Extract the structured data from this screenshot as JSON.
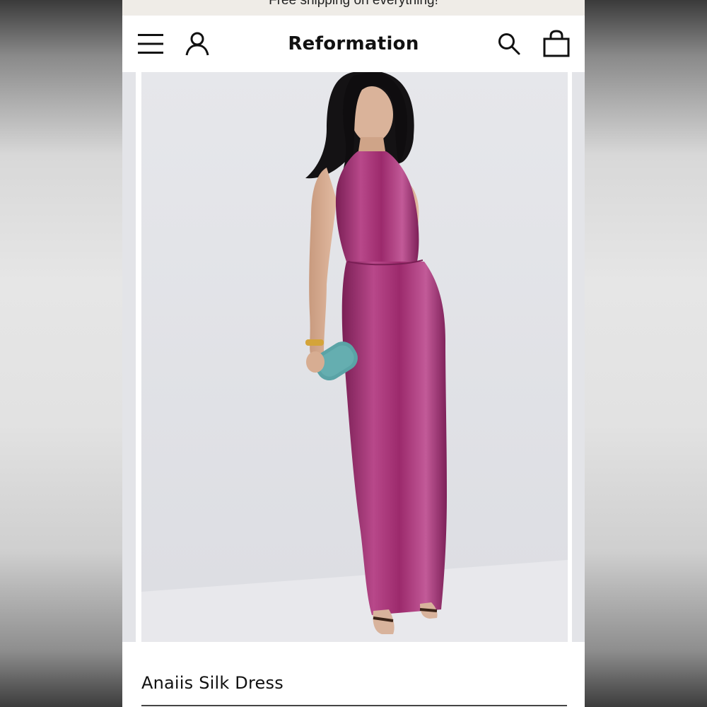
{
  "promo": {
    "text": "Free shipping on everything!"
  },
  "header": {
    "brand": "Reformation",
    "icons": [
      "menu-icon",
      "account-icon",
      "search-icon",
      "bag-icon"
    ]
  },
  "gallery": {
    "background_color": "#e3e4e8",
    "dress_color": "#9c2a6c",
    "clutch_color": "#5aa3a6"
  },
  "product": {
    "name": "Anaiis Silk Dress"
  }
}
